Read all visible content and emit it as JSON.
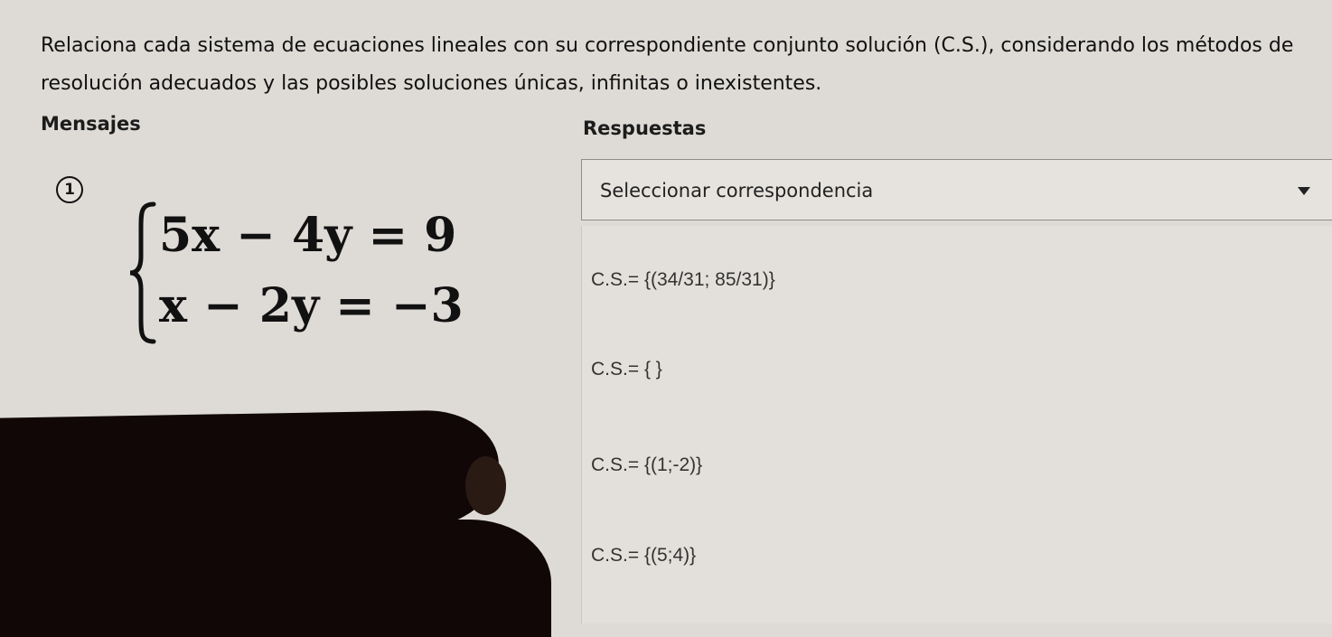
{
  "instructions": "Relaciona cada sistema de ecuaciones lineales con su correspondiente conjunto solución (C.S.), considerando los métodos de resolución adecuados y las posibles soluciones únicas, infinitas o inexistentes.",
  "columns": {
    "left_header": "Mensajes",
    "right_header": "Respuestas"
  },
  "question": {
    "number": "1",
    "equation_1": "5x − 4y = 9",
    "equation_2": "x − 2y = −3"
  },
  "select": {
    "placeholder": "Seleccionar correspondencia"
  },
  "options": [
    "C.S.= {(34/31; 85/31)}",
    "C.S.= { }",
    "C.S.= {(1;-2)}",
    "C.S.= {(5;4)}"
  ]
}
